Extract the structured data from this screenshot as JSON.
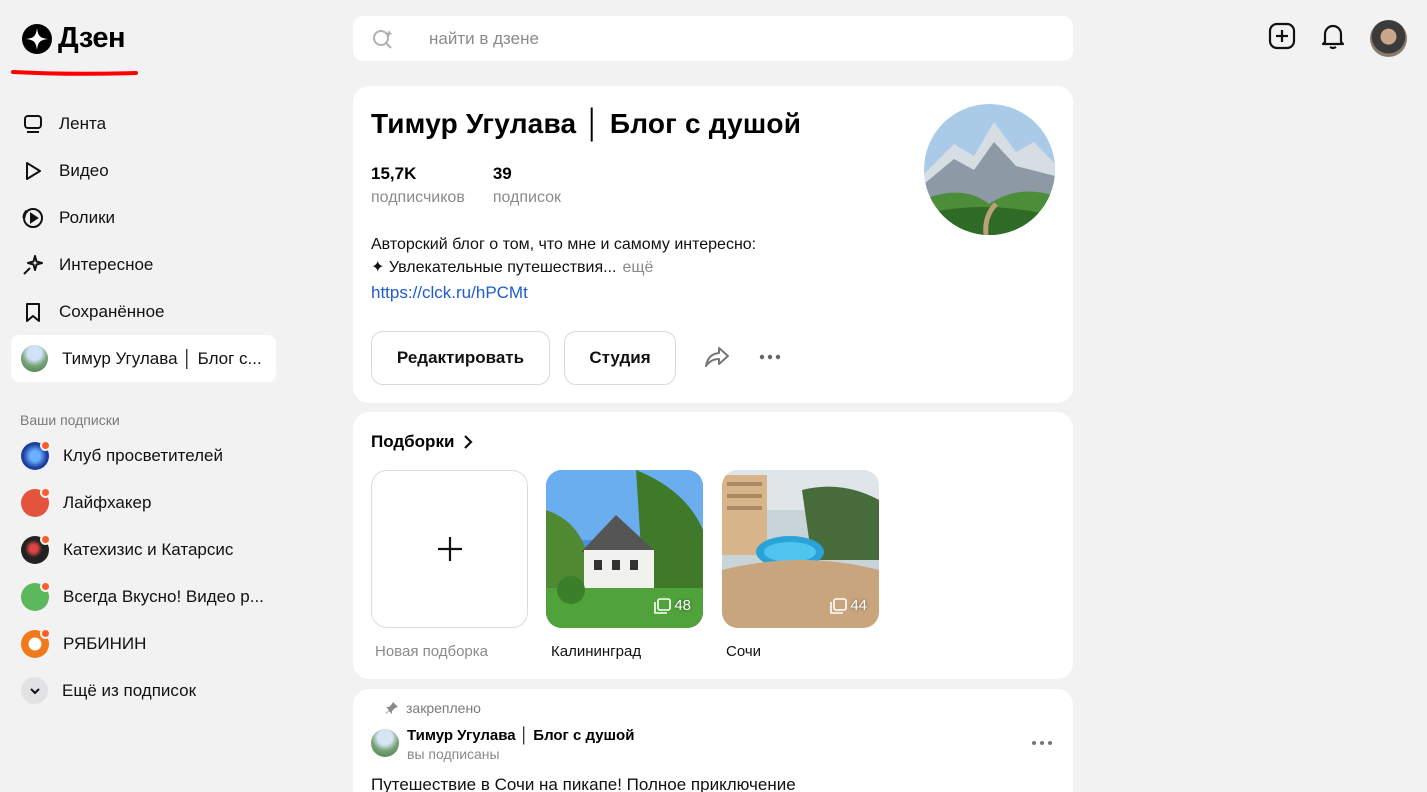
{
  "brand": {
    "name": "Дзен"
  },
  "nav": {
    "items": [
      {
        "label": "Лента",
        "icon": "feed-icon"
      },
      {
        "label": "Видео",
        "icon": "play-icon"
      },
      {
        "label": "Ролики",
        "icon": "shorts-icon"
      },
      {
        "label": "Интересное",
        "icon": "sparkle-icon"
      },
      {
        "label": "Сохранённое",
        "icon": "bookmark-icon"
      },
      {
        "label": "Тимур Угулава │ Блог с...",
        "icon": "channel-avatar"
      }
    ]
  },
  "subscriptions": {
    "heading": "Ваши подписки",
    "items": [
      {
        "label": "Клуб просветителей",
        "color": "#1d3f9c"
      },
      {
        "label": "Лайфхакер",
        "color": "#e2553c"
      },
      {
        "label": "Катехизис и Катарсис",
        "color": "#222222"
      },
      {
        "label": "Всегда Вкусно! Видео р...",
        "color": "#5cb85c"
      },
      {
        "label": "РЯБИНИН",
        "color": "#f07a1a"
      }
    ],
    "more_label": "Ещё из подписок"
  },
  "search": {
    "placeholder": "найти в дзене"
  },
  "channel": {
    "title": "Тимур Угулава │ Блог с душой",
    "subscribers": {
      "value": "15,7K",
      "label": "подписчиков"
    },
    "subscriptions": {
      "value": "39",
      "label": "подписок"
    },
    "description_line1": "Авторский блог о том, что мне и самому интересно:",
    "description_line2": "✦ Увлекательные путешествия...",
    "description_more": "ещё",
    "link": "https://clck.ru/hPCMt",
    "edit_label": "Редактировать",
    "studio_label": "Студия"
  },
  "collections": {
    "title": "Подборки",
    "new_label": "Новая подборка",
    "items": [
      {
        "name": "Калининград",
        "count": "48"
      },
      {
        "name": "Сочи",
        "count": "44"
      }
    ]
  },
  "post": {
    "pinned_label": "закреплено",
    "author": "Тимур Угулава │ Блог с душой",
    "subtitle": "вы подписаны",
    "title": "Путешествие в Сочи на пикапе! Полное приключение"
  },
  "colors": {
    "accent_red": "#ff0000",
    "link_blue": "#1e5bd0",
    "background": "#f2f2f3",
    "notification_dot": "#ff5c2b"
  }
}
